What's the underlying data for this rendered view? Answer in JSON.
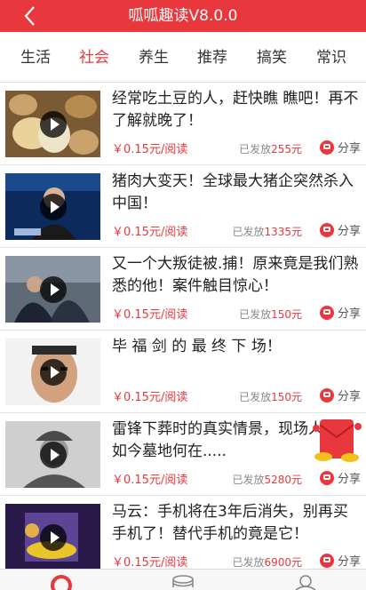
{
  "header": {
    "title": "呱呱趣读V8.0.0"
  },
  "tabs": [
    {
      "label": "生活",
      "active": false
    },
    {
      "label": "社会",
      "active": true
    },
    {
      "label": "养生",
      "active": false
    },
    {
      "label": "推荐",
      "active": false
    },
    {
      "label": "搞笑",
      "active": false
    },
    {
      "label": "常识",
      "active": false
    }
  ],
  "articles": [
    {
      "title": "经常吃土豆的人，赶快瞧 瞧吧！再不了解就晚了！",
      "price": "￥0.15元/阅读",
      "paid_prefix": "已发放",
      "paid_amount": "255元",
      "share": "分享",
      "thumb": "potatoes"
    },
    {
      "title": "猪肉大变天！全球最大猪企突然杀入中国！",
      "price": "￥0.15元/阅读",
      "paid_prefix": "已发放",
      "paid_amount": "1335元",
      "share": "分享",
      "thumb": "news-anchor"
    },
    {
      "title": "又一个大叛徒被.捕！原来竟是我们熟悉的他！案件触目惊心！",
      "price": "￥0.15元/阅读",
      "paid_prefix": "已发放",
      "paid_amount": "150元",
      "share": "分享",
      "thumb": "arrest"
    },
    {
      "title": "毕 福 剑 的 最 终 下 场！",
      "price": "￥0.15元/阅读",
      "paid_prefix": "已发放",
      "paid_amount": "150元",
      "share": "分享",
      "thumb": "portrait"
    },
    {
      "title": "雷锋下葬时的真实情景，现场人海，如今墓地何在.....",
      "price": "￥0.15元/阅读",
      "paid_prefix": "已发放",
      "paid_amount": "5280元",
      "share": "分享",
      "thumb": "soldier"
    },
    {
      "title": "马云：手机将在3年后消失，别再买手机了！替代手机的竟是它！",
      "price": "￥0.15元/阅读",
      "paid_prefix": "已发放",
      "paid_amount": "6900元",
      "share": "分享",
      "thumb": "gadget"
    }
  ],
  "colors": {
    "accent": "#e8383d",
    "header_bg": "#e8383d"
  },
  "bottom_nav": [
    "home-icon",
    "coins-icon",
    "user-icon"
  ]
}
